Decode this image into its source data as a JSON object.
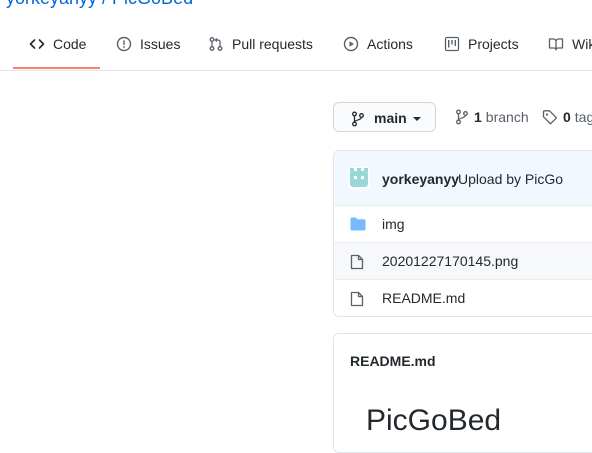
{
  "repo": {
    "name": "yorkeyanyy / PicGoBed"
  },
  "nav": {
    "tabs": [
      {
        "label": "Code",
        "icon": "code-icon"
      },
      {
        "label": "Issues",
        "icon": "issue-icon"
      },
      {
        "label": "Pull requests",
        "icon": "pull-request-icon"
      },
      {
        "label": "Actions",
        "icon": "play-icon"
      },
      {
        "label": "Projects",
        "icon": "project-icon"
      },
      {
        "label": "Wiki",
        "icon": "book-icon"
      }
    ]
  },
  "branch": {
    "current": "main",
    "branch_count": "1",
    "branch_label": "branch",
    "tag_count": "0",
    "tag_label": "tags"
  },
  "commit": {
    "author": "yorkeyanyy",
    "message": "Upload by PicGo"
  },
  "files": [
    {
      "name": "img",
      "type": "folder"
    },
    {
      "name": "20201227170145.png",
      "type": "file"
    },
    {
      "name": "README.md",
      "type": "file"
    }
  ],
  "readme": {
    "filename": "README.md",
    "heading": "PicGoBed"
  },
  "colors": {
    "accent_underline": "#f9826c",
    "folder": "#79b8ff",
    "commit_bg": "#f1f8ff",
    "avatar": "#9ad8d8"
  }
}
